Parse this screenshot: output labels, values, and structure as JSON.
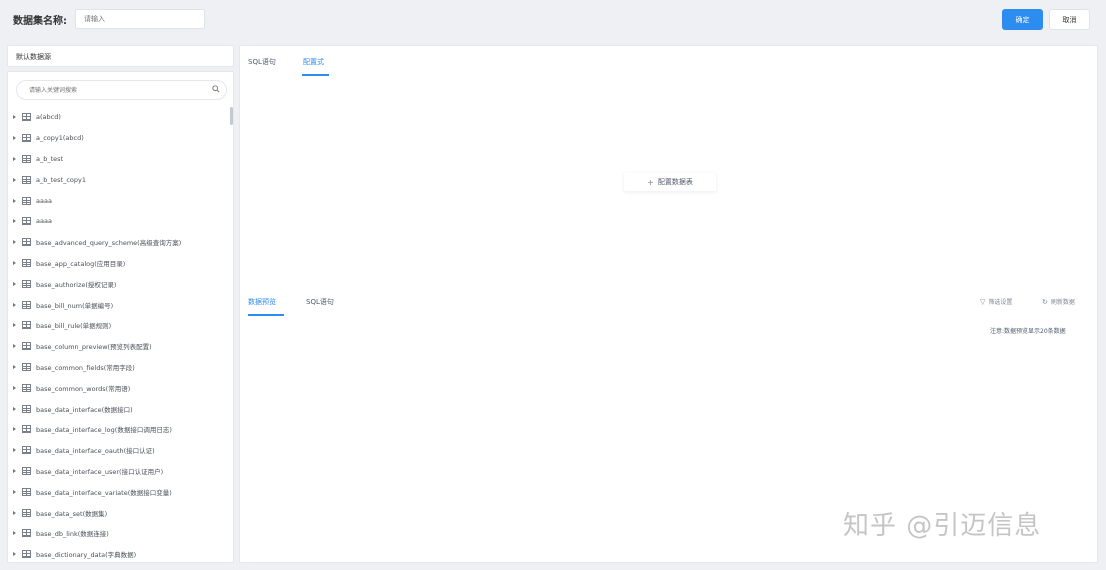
{
  "header": {
    "dataset_name_label": "数据集名称:",
    "dataset_name_placeholder": "请输入",
    "confirm_label": "确定",
    "cancel_label": "取消"
  },
  "sidebar": {
    "datasource_label": "默认数据源",
    "search_placeholder": "请输入关键词搜索",
    "tables": [
      "a(abcd)",
      "a_copy1(abcd)",
      "a_b_test",
      "a_b_test_copy1",
      "aaaa",
      "aaaa",
      "base_advanced_query_scheme(高级查询方案)",
      "base_app_catalog(应用目录)",
      "base_authorize(授权记录)",
      "base_bill_num(单据编号)",
      "base_bill_rule(单据规则)",
      "base_column_preview(预览列表配置)",
      "base_common_fields(常用字段)",
      "base_common_words(常用语)",
      "base_data_interface(数据接口)",
      "base_data_interface_log(数据接口调用日志)",
      "base_data_interface_oauth(接口认证)",
      "base_data_interface_user(接口认证用户)",
      "base_data_interface_variate(数据接口变量)",
      "base_data_set(数据集)",
      "base_db_link(数据连接)",
      "base_dictionary_data(字典数据)"
    ]
  },
  "main": {
    "top_tabs": [
      {
        "label": "SQL语句"
      },
      {
        "label": "配置式"
      }
    ],
    "canvas_hint": "配置数据表",
    "bottom_tabs": [
      {
        "label": "数据预览"
      },
      {
        "label": "SQL语句"
      }
    ],
    "filter_label": "筛选设置",
    "refresh_label": "刷新数据",
    "info_text": "注意:数据预览显示20条数据"
  },
  "watermark": "知乎 @引迈信息",
  "colors": {
    "accent": "#2d8cf0",
    "background": "#eef0f4"
  }
}
